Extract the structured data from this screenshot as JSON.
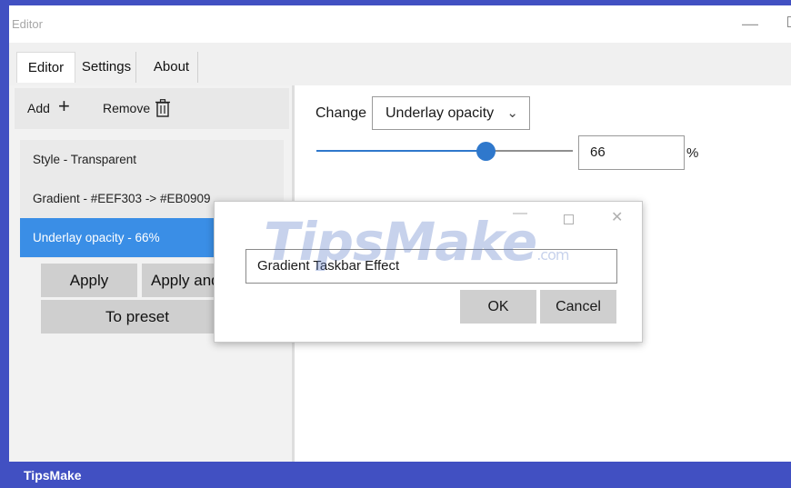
{
  "window": {
    "title": "Editor"
  },
  "tabs": [
    {
      "label": "Editor",
      "active": true
    },
    {
      "label": "Settings",
      "active": false
    },
    {
      "label": "About",
      "active": false
    }
  ],
  "toolbar": {
    "add_label": "Add",
    "remove_label": "Remove"
  },
  "effects_list": {
    "items": [
      {
        "label": "Style - Transparent",
        "selected": false
      },
      {
        "label": "Gradient - #EEF303 -> #EB0909",
        "selected": false
      },
      {
        "label": "Underlay opacity - 66%",
        "selected": true
      }
    ]
  },
  "buttons": {
    "apply": "Apply",
    "apply_and": "Apply and",
    "to_preset": "To preset"
  },
  "editor": {
    "change_label": "Change",
    "change_selected": "Underlay opacity",
    "slider_fraction": 0.66,
    "value": "66",
    "unit": "%"
  },
  "dialog": {
    "input_value": "Gradient Taskbar Effect",
    "ok_label": "OK",
    "cancel_label": "Cancel"
  },
  "watermark": {
    "main": "TipsMake",
    "suffix": ".com"
  },
  "status": {
    "brand": "TipsMake"
  },
  "colors": {
    "accent": "#3a8ee6",
    "brand": "#4150c2",
    "slider": "#2f78cc"
  }
}
